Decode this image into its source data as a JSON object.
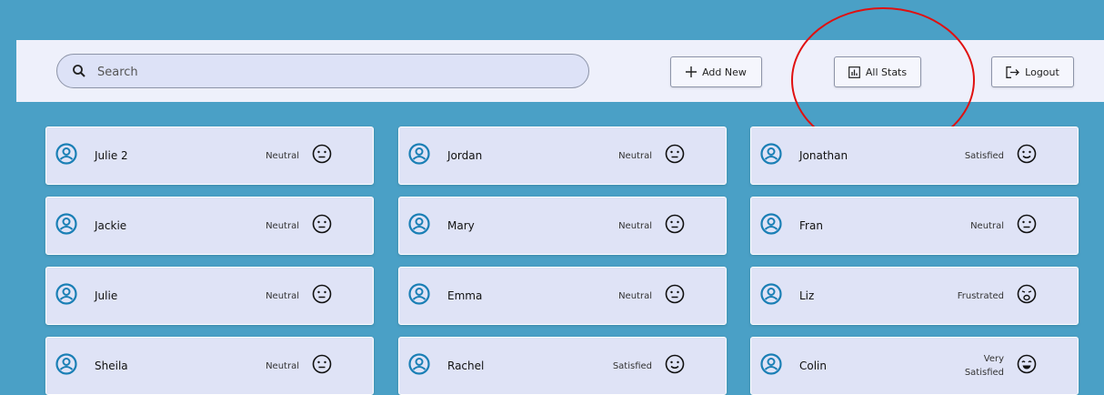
{
  "search": {
    "placeholder": "Search"
  },
  "toolbar": {
    "add_label": "Add New",
    "stats_label": "All Stats",
    "logout_label": "Logout"
  },
  "customers": [
    {
      "name": "Julie 2",
      "status": "Neutral",
      "mood": "neutral"
    },
    {
      "name": "Jordan",
      "status": "Neutral",
      "mood": "neutral"
    },
    {
      "name": "Jonathan",
      "status": "Satisfied",
      "mood": "satisfied"
    },
    {
      "name": "Jackie",
      "status": "Neutral",
      "mood": "neutral"
    },
    {
      "name": "Mary",
      "status": "Neutral",
      "mood": "neutral"
    },
    {
      "name": "Fran",
      "status": "Neutral",
      "mood": "neutral"
    },
    {
      "name": "Julie",
      "status": "Neutral",
      "mood": "neutral"
    },
    {
      "name": "Emma",
      "status": "Neutral",
      "mood": "neutral"
    },
    {
      "name": "Liz",
      "status": "Frustrated",
      "mood": "frustrated"
    },
    {
      "name": "Sheila",
      "status": "Neutral",
      "mood": "neutral"
    },
    {
      "name": "Rachel",
      "status": "Satisfied",
      "mood": "satisfied"
    },
    {
      "name": "Colin",
      "status": "Very Satisfied",
      "mood": "very-satisfied"
    }
  ],
  "colors": {
    "background": "#4aa0c6",
    "card": "#dfe3f6",
    "accent": "#1a7fb5",
    "annotation": "#e01010"
  }
}
